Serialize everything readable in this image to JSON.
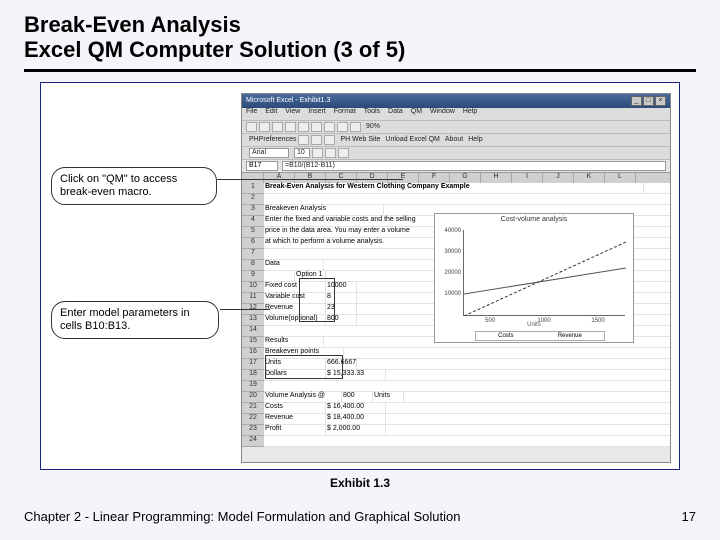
{
  "slide": {
    "title_line1": "Break-Even Analysis",
    "title_line2": "Excel QM Computer Solution (3 of 5)",
    "caption": "Exhibit 1.3",
    "footer_left": "Chapter 2 - Linear Programming:  Model Formulation and Graphical Solution",
    "page_number": "17"
  },
  "callouts": {
    "c1": "Click on \"QM\" to access break-even macro.",
    "c2": "Enter model parameters in cells B10:B13."
  },
  "excel": {
    "title": "Microsoft Excel - Exhibit1.3",
    "menus": [
      "File",
      "Edit",
      "View",
      "Insert",
      "Format",
      "Tools",
      "Data",
      "QM",
      "Window",
      "Help"
    ],
    "toolbar2": {
      "pref": "PHPreferences",
      "btns": [
        "",
        "",
        "",
        "",
        "",
        "",
        "",
        ""
      ],
      "webleft": "PH Web Site",
      "unload": "Unload Excel QM",
      "about": "About",
      "help": "Help"
    },
    "toolbar3": {
      "font": "Arial",
      "size": "10",
      "zoom": "90%"
    },
    "namebox": "B17",
    "formula": "=B10/(B12-B11)",
    "cols": [
      "A",
      "B",
      "C",
      "D",
      "E",
      "F",
      "G",
      "H",
      "I",
      "J",
      "K",
      "L"
    ],
    "rows_count": 24,
    "sheet_title": "Break-Even Analysis for Western Clothing Company Example",
    "r3": "Breakeven Analysis",
    "r4": "Enter the fixed and variable costs and the selling",
    "r5": "price in the data area. You may enter a volume",
    "r6": "at which to perform a volume analysis.",
    "r8": "Data",
    "r9_b": "Option 1",
    "r10_a": "Fixed cost",
    "r10_b": "10000",
    "r11_a": "Variable cost",
    "r11_b": "8",
    "r12_a": "Revenue",
    "r12_b": "23",
    "r13_a": "Volume(optional)",
    "r13_b": "800",
    "r15_a": "Results",
    "r16_a": "Breakeven points",
    "r17_a": "Units",
    "r17_b": "666.6667",
    "r18_a": "Dollars",
    "r18_b": "$  15,333.33",
    "r20_a": "Volume Analysis @",
    "r20_b": "800",
    "r20_c": "Units",
    "r21_a": "Costs",
    "r21_b": "$  16,400.00",
    "r22_a": "Revenue",
    "r22_b": "$  18,400.00",
    "r23_a": "Profit",
    "r23_b": "$    2,000.00"
  },
  "chart_data": {
    "type": "line",
    "title": "Cost-volume analysis",
    "xlabel": "Units",
    "ylim": [
      0,
      40000
    ],
    "yticks": [
      "40000",
      "30000",
      "20000",
      "10000"
    ],
    "xticks": [
      "500",
      "1000",
      "1500"
    ],
    "series": [
      {
        "name": "Costs",
        "points": [
          [
            0,
            10000
          ],
          [
            1500,
            22000
          ]
        ]
      },
      {
        "name": "Revenue",
        "points": [
          [
            0,
            0
          ],
          [
            1500,
            34500
          ]
        ]
      }
    ]
  }
}
